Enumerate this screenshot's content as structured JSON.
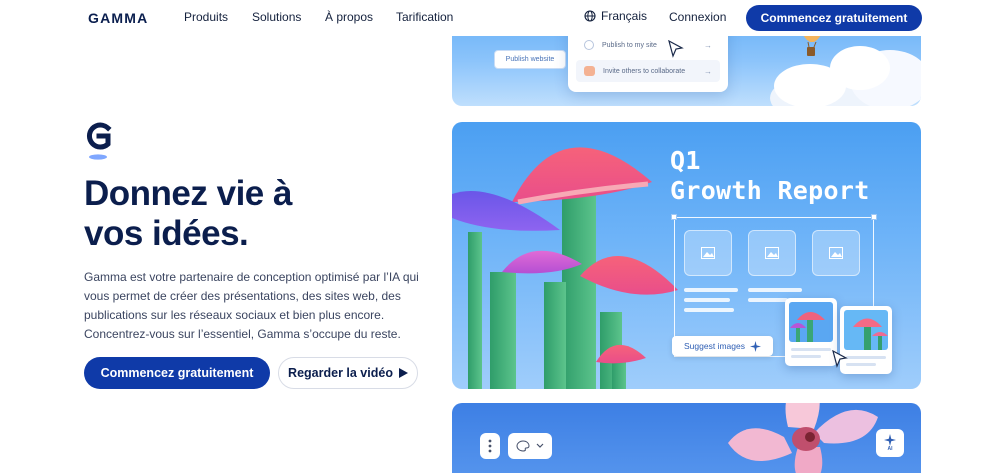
{
  "nav": {
    "logo": "GAMMA",
    "links": [
      "Produits",
      "Solutions",
      "À propos",
      "Tarification"
    ],
    "language": "Français",
    "login": "Connexion",
    "cta": "Commencez gratuitement"
  },
  "hero": {
    "title_line1": "Donnez vie à",
    "title_line2": "vos idées.",
    "description": "Gamma est votre partenaire de conception optimisé par l’IA qui vous permet de créer des présentations, des sites web, des publications sur les réseaux sociaux et bien plus encore. Concentrez-vous sur l’essentiel, Gamma s’occupe du reste.",
    "primary_button": "Commencez gratuitement",
    "secondary_button": "Regarder la vidéo"
  },
  "panel_publish": {
    "publish_button": "Publish website",
    "menu": [
      "Publish to my site",
      "Invite others to collaborate"
    ]
  },
  "panel_report": {
    "title_line1": "Q1",
    "title_line2": "Growth Report",
    "suggest_button": "Suggest images"
  },
  "panel_bottom": {
    "ai_badge": "AI"
  },
  "colors": {
    "brand_navy": "#0b1e4d",
    "cta_blue": "#0f3aa8",
    "panel_blue": "#4b9ff2"
  }
}
